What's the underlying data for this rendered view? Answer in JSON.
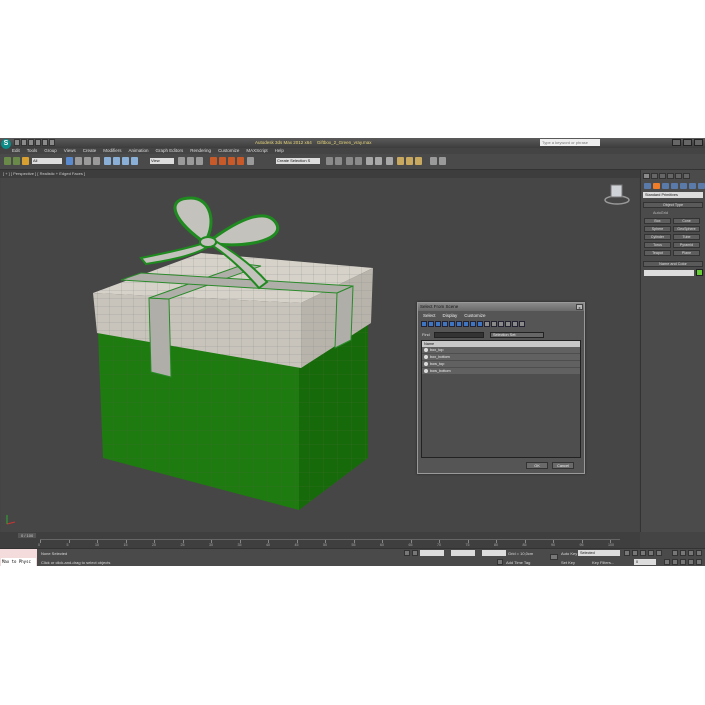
{
  "window": {
    "app_title": "Autodesk 3ds Max 2012 x64",
    "file_name": "Giftbox_2_Green_vray.max",
    "search_placeholder": "Type a keyword or phrase"
  },
  "menu": [
    "Edit",
    "Tools",
    "Group",
    "Views",
    "Create",
    "Modifiers",
    "Animation",
    "Graph Editors",
    "Rendering",
    "Customize",
    "MAXScript",
    "Help"
  ],
  "toolbar": {
    "selection_filter": "All",
    "reference_coord": "View",
    "named_selection": "Create Selection S"
  },
  "viewport": {
    "label": "[ + ] [ Perspective ] [ Realistic + Edged Faces ]"
  },
  "command_panel": {
    "dropdown": "Standard Primitives",
    "object_type_header": "Object Type",
    "autogrid_label": "AutoGrid",
    "buttons": [
      "Box",
      "Cone",
      "Sphere",
      "GeoSphere",
      "Cylinder",
      "Tube",
      "Torus",
      "Pyramid",
      "Teapot",
      "Plane"
    ],
    "name_color_header": "Name and Color",
    "name_color_swatch": "#66cc33"
  },
  "dialog": {
    "title": "Select From Scene",
    "close": "x",
    "menu": [
      "Select",
      "Display",
      "Customize"
    ],
    "find_label": "Find",
    "selection_set": "Selection Set:",
    "column_header": "Name",
    "rows": [
      "box_top",
      "box_bottom",
      "bow_top",
      "bow_bottom"
    ],
    "ok": "OK",
    "cancel": "Cancel"
  },
  "timeline": {
    "frame_counter": "0 / 100",
    "ticks": [
      "0",
      "5",
      "10",
      "15",
      "20",
      "25",
      "30",
      "35",
      "40",
      "45",
      "50",
      "55",
      "60",
      "65",
      "70",
      "75",
      "80",
      "85",
      "90",
      "95",
      "100"
    ]
  },
  "status": {
    "maxscript_text": "Max to Physc",
    "none_selected": "None Selected",
    "prompt": "Click or click-and-drag to select objects",
    "grid": "Grid = 10,0cm",
    "add_time_tag": "Add Time Tag",
    "auto_key": "Auto Key",
    "set_key": "Set Key",
    "selected": "Selected",
    "key_filters": "Key Filters...",
    "frame": "0"
  }
}
